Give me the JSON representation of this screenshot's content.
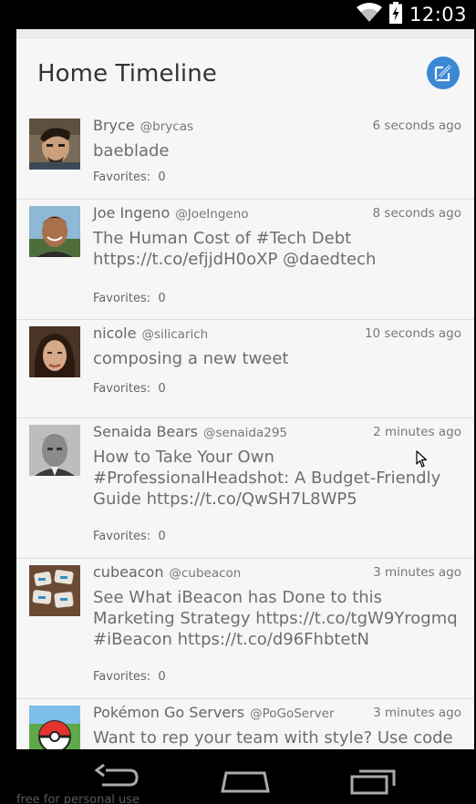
{
  "status_bar": {
    "time": "12:03"
  },
  "header": {
    "title": "Home Timeline"
  },
  "tweets": [
    {
      "name": "Bryce",
      "handle": "@brycas",
      "time": "6 seconds ago",
      "text": "baeblade",
      "favorites_label": "Favorites:",
      "favorites": "0"
    },
    {
      "name": "Joe Ingeno",
      "handle": "@JoeIngeno",
      "time": "8 seconds ago",
      "text": "The Human Cost of #Tech Debt https://t.co/efjjdH0oXP @daedtech",
      "favorites_label": "Favorites:",
      "favorites": "0"
    },
    {
      "name": "nicole",
      "handle": "@silicarich",
      "time": "10 seconds ago",
      "text": "composing a new tweet",
      "favorites_label": "Favorites:",
      "favorites": "0"
    },
    {
      "name": "Senaida Bears",
      "handle": "@senaida295",
      "time": "2 minutes ago",
      "text": "How to Take Your Own #ProfessionalHeadshot: A Budget-Friendly Guide https://t.co/QwSH7L8WP5",
      "favorites_label": "Favorites:",
      "favorites": "0"
    },
    {
      "name": "cubeacon",
      "handle": "@cubeacon",
      "time": "3 minutes ago",
      "text": "See What iBeacon has Done to this Marketing Strategy https://t.co/tgW9Yrogmq #iBeacon https://t.co/d96FhbtetN",
      "favorites_label": "Favorites:",
      "favorites": "0"
    },
    {
      "name": "Pokémon Go Servers",
      "handle": "@PoGoServer",
      "time": "3 minutes ago",
      "text": "Want to rep your team with style? Use code",
      "favorites_label": "",
      "favorites": ""
    }
  ],
  "watermark": "free for personal use",
  "icons": {
    "compose": "compose-icon",
    "wifi": "wifi-icon",
    "battery": "battery-charging-icon",
    "back": "back-icon",
    "home": "home-icon",
    "recents": "recent-apps-icon"
  },
  "colors": {
    "accent": "#3a87d3",
    "background": "#f6f6f6",
    "divider": "#dedede"
  }
}
